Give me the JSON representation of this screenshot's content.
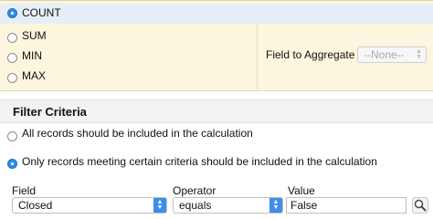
{
  "aggregation": {
    "options": [
      {
        "label": "COUNT",
        "checked": true
      },
      {
        "label": "SUM",
        "checked": false
      },
      {
        "label": "MIN",
        "checked": false
      },
      {
        "label": "MAX",
        "checked": false
      }
    ],
    "field_to_aggregate_label": "Field to Aggregate",
    "field_to_aggregate_value": "--None--"
  },
  "filter": {
    "title": "Filter Criteria",
    "options": [
      {
        "label": "All records should be included in the calculation",
        "checked": false
      },
      {
        "label": "Only records meeting certain criteria should be included in the calculation",
        "checked": true
      }
    ],
    "columns": {
      "field": "Field",
      "operator": "Operator",
      "value": "Value"
    },
    "row": {
      "field": "Closed",
      "operator": "equals",
      "value": "False"
    }
  },
  "colors": {
    "accent": "#2f8de4",
    "panel": "#fbf6dd",
    "highlight": "#e8eef8"
  },
  "icons": {
    "lookup": "magnifier-lookup-icon"
  }
}
